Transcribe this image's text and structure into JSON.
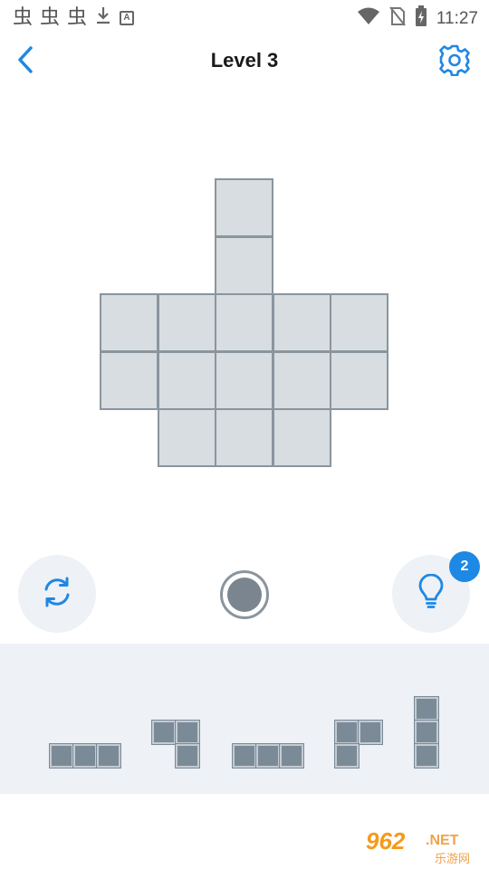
{
  "status_bar": {
    "left_glyphs": [
      "虫",
      "虫",
      "虫"
    ],
    "download_icon": "download-icon",
    "keyboard_badge": "A",
    "time": "11:27"
  },
  "header": {
    "title": "Level 3",
    "back_icon": "chevron-left-icon",
    "settings_icon": "gear-icon",
    "accent_color": "#1e88e5"
  },
  "board": {
    "rows": 5,
    "cols": 5,
    "filled_cells": [
      [
        0,
        2
      ],
      [
        1,
        2
      ],
      [
        2,
        0
      ],
      [
        2,
        1
      ],
      [
        2,
        2
      ],
      [
        2,
        3
      ],
      [
        2,
        4
      ],
      [
        3,
        0
      ],
      [
        3,
        1
      ],
      [
        3,
        2
      ],
      [
        3,
        3
      ],
      [
        3,
        4
      ],
      [
        4,
        1
      ],
      [
        4,
        2
      ],
      [
        4,
        3
      ]
    ],
    "cell_color": "#d7dde1",
    "border_color": "#8a959e"
  },
  "controls": {
    "restart_icon": "refresh-icon",
    "center_icon": "record-icon",
    "hint_icon": "lightbulb-icon",
    "hint_count": "2"
  },
  "pieces": [
    {
      "shape": "I3-horizontal",
      "cells": [
        [
          0,
          0
        ],
        [
          0,
          1
        ],
        [
          0,
          2
        ]
      ]
    },
    {
      "shape": "L-top-right",
      "cells": [
        [
          0,
          0
        ],
        [
          0,
          1
        ],
        [
          1,
          1
        ]
      ]
    },
    {
      "shape": "I3-horizontal",
      "cells": [
        [
          0,
          0
        ],
        [
          0,
          1
        ],
        [
          0,
          2
        ]
      ]
    },
    {
      "shape": "L-top-left",
      "cells": [
        [
          0,
          0
        ],
        [
          0,
          1
        ],
        [
          1,
          0
        ]
      ]
    },
    {
      "shape": "I3-vertical",
      "cells": [
        [
          0,
          0
        ],
        [
          1,
          0
        ],
        [
          2,
          0
        ]
      ]
    }
  ],
  "watermark": {
    "main": "962",
    "net": ".NET",
    "sub": "乐游网"
  }
}
